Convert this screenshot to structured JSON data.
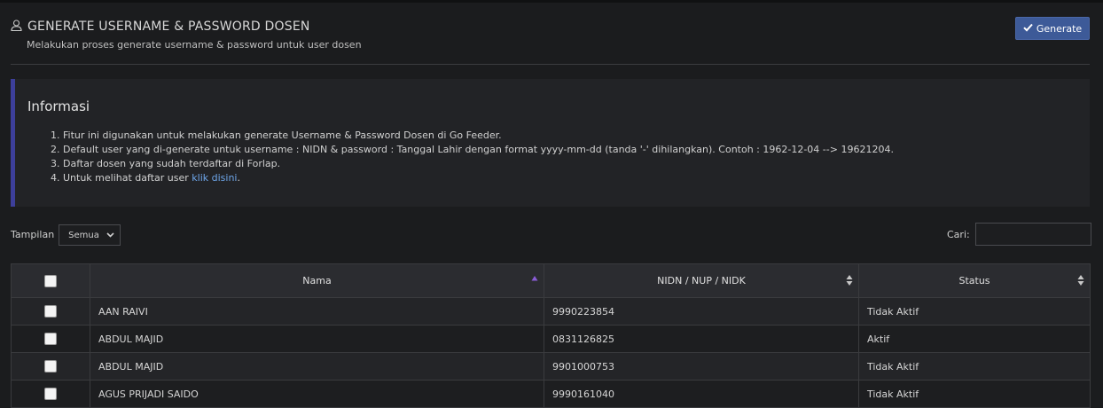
{
  "header": {
    "title": "GENERATE USERNAME & PASSWORD DOSEN",
    "subtitle": "Melakukan proses generate username & password untuk user dosen",
    "icon": "user-icon"
  },
  "toolbar": {
    "generate_label": "Generate",
    "generate_icon": "check-icon"
  },
  "info": {
    "heading": "Informasi",
    "items": [
      "Fitur ini digunakan untuk melakukan generate Username & Password Dosen di Go Feeder.",
      "Default user yang di-generate untuk username : NIDN & password : Tanggal Lahir dengan format yyyy-mm-dd (tanda '-' dihilangkan). Contoh : 1962-12-04 --> 19621204.",
      "Daftar dosen yang sudah terdaftar di Forlap."
    ],
    "last_item_prefix": "Untuk melihat daftar user ",
    "link_text": "klik disini",
    "last_item_suffix": "."
  },
  "controls": {
    "tampilan_label": "Tampilan",
    "tampilan_value": "Semua",
    "cari_label": "Cari:",
    "cari_value": ""
  },
  "table": {
    "columns": [
      "Nama",
      "NIDN / NUP / NIDK",
      "Status"
    ],
    "rows": [
      {
        "nama": "AAN RAIVI",
        "nidn": "9990223854",
        "status": "Tidak Aktif"
      },
      {
        "nama": "ABDUL MAJID",
        "nidn": "0831126825",
        "status": "Aktif"
      },
      {
        "nama": "ABDUL MAJID",
        "nidn": "9901000753",
        "status": "Tidak Aktif"
      },
      {
        "nama": "AGUS PRIJADI SAIDO",
        "nidn": "9990161040",
        "status": "Tidak Aktif"
      }
    ]
  },
  "colors": {
    "background": "#1b1c1e",
    "accent": "#3d5a98",
    "info_border": "#3d3f9a",
    "link": "#6ea6ea",
    "sort_active": "#8a5cd6"
  }
}
